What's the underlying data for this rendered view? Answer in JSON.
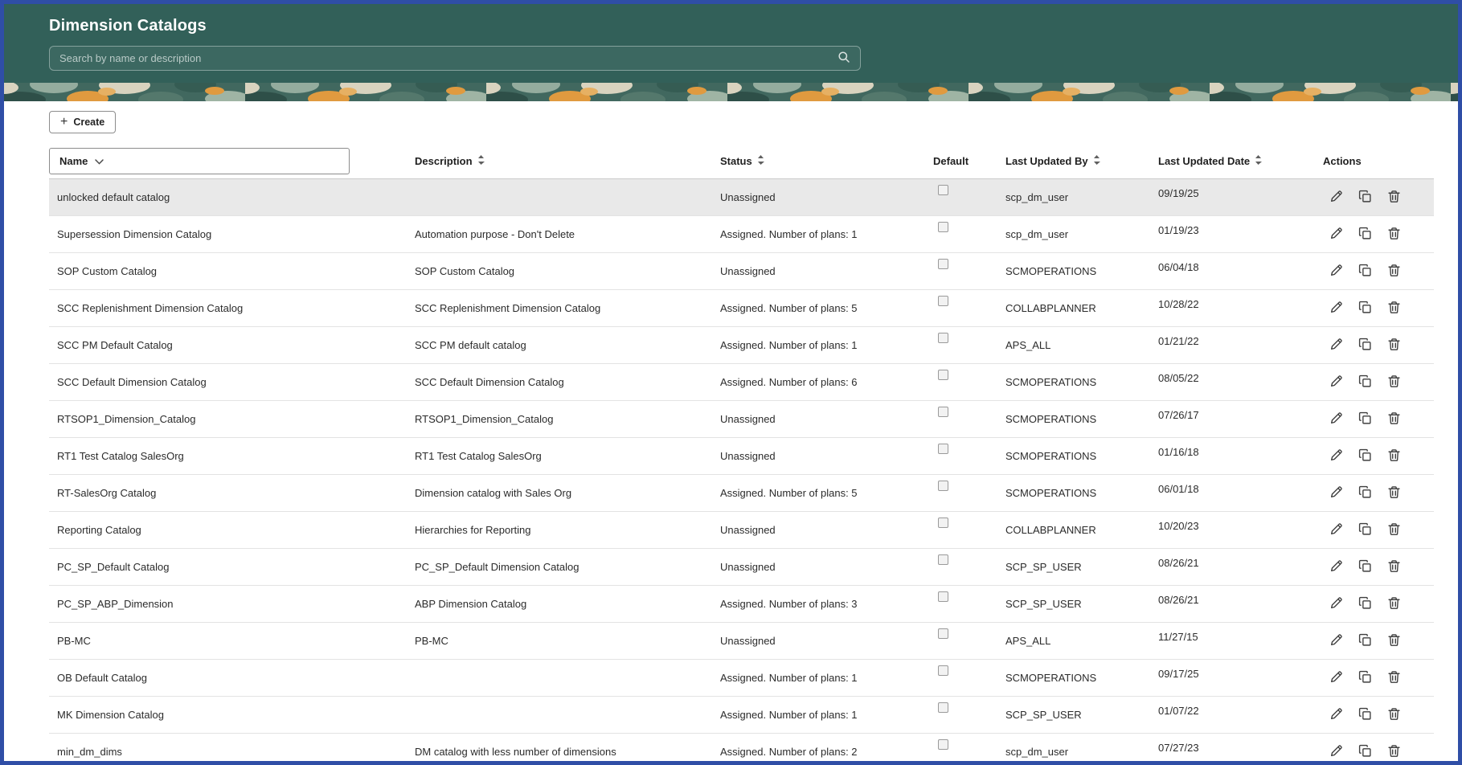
{
  "header": {
    "title": "Dimension Catalogs",
    "search_placeholder": "Search by name or description"
  },
  "toolbar": {
    "plus_glyph": "+",
    "create_label": "Create"
  },
  "colors": {
    "header_teal": "#326059",
    "frame_blue": "#2f4ea6",
    "banner_orange": "#e09a3f",
    "selected_row_gray": "#e9e9e9"
  },
  "table": {
    "columns": [
      "Name",
      "Description",
      "Status",
      "Default",
      "Last Updated By",
      "Last Updated Date",
      "Actions"
    ],
    "row_actions": [
      "edit-icon",
      "duplicate-icon",
      "delete-icon"
    ],
    "rows": [
      {
        "name": "unlocked default catalog",
        "description": "",
        "status": "Unassigned",
        "default": false,
        "last_updated_by": "scp_dm_user",
        "last_updated_date": "09/19/25",
        "selected": true
      },
      {
        "name": "Supersession Dimension Catalog",
        "description": "Automation purpose - Don't Delete",
        "status": "Assigned. Number of plans: 1",
        "default": false,
        "last_updated_by": "scp_dm_user",
        "last_updated_date": "01/19/23"
      },
      {
        "name": "SOP Custom Catalog",
        "description": "SOP Custom Catalog",
        "status": "Unassigned",
        "default": false,
        "last_updated_by": "SCMOPERATIONS",
        "last_updated_date": "06/04/18"
      },
      {
        "name": "SCC Replenishment Dimension Catalog",
        "description": "SCC Replenishment Dimension Catalog",
        "status": "Assigned. Number of plans: 5",
        "default": false,
        "last_updated_by": "COLLABPLANNER",
        "last_updated_date": "10/28/22"
      },
      {
        "name": "SCC PM Default Catalog",
        "description": "SCC PM default catalog",
        "status": "Assigned. Number of plans: 1",
        "default": false,
        "last_updated_by": "APS_ALL",
        "last_updated_date": "01/21/22"
      },
      {
        "name": "SCC Default Dimension Catalog",
        "description": "SCC Default Dimension Catalog",
        "status": "Assigned. Number of plans: 6",
        "default": false,
        "last_updated_by": "SCMOPERATIONS",
        "last_updated_date": "08/05/22"
      },
      {
        "name": "RTSOP1_Dimension_Catalog",
        "description": "RTSOP1_Dimension_Catalog",
        "status": "Unassigned",
        "default": false,
        "last_updated_by": "SCMOPERATIONS",
        "last_updated_date": "07/26/17"
      },
      {
        "name": "RT1 Test Catalog SalesOrg",
        "description": "RT1 Test Catalog SalesOrg",
        "status": "Unassigned",
        "default": false,
        "last_updated_by": "SCMOPERATIONS",
        "last_updated_date": "01/16/18"
      },
      {
        "name": "RT-SalesOrg Catalog",
        "description": "Dimension catalog with Sales Org",
        "status": "Assigned. Number of plans: 5",
        "default": false,
        "last_updated_by": "SCMOPERATIONS",
        "last_updated_date": "06/01/18"
      },
      {
        "name": "Reporting Catalog",
        "description": "Hierarchies for Reporting",
        "status": "Unassigned",
        "default": false,
        "last_updated_by": "COLLABPLANNER",
        "last_updated_date": "10/20/23"
      },
      {
        "name": "PC_SP_Default Catalog",
        "description": "PC_SP_Default Dimension Catalog",
        "status": "Unassigned",
        "default": false,
        "last_updated_by": "SCP_SP_USER",
        "last_updated_date": "08/26/21"
      },
      {
        "name": "PC_SP_ABP_Dimension",
        "description": "ABP Dimension Catalog",
        "status": "Assigned. Number of plans: 3",
        "default": false,
        "last_updated_by": "SCP_SP_USER",
        "last_updated_date": "08/26/21"
      },
      {
        "name": "PB-MC",
        "description": "PB-MC",
        "status": "Unassigned",
        "default": false,
        "last_updated_by": "APS_ALL",
        "last_updated_date": "11/27/15"
      },
      {
        "name": "OB Default Catalog",
        "description": "",
        "status": "Assigned. Number of plans: 1",
        "default": false,
        "last_updated_by": "SCMOPERATIONS",
        "last_updated_date": "09/17/25"
      },
      {
        "name": "MK Dimension Catalog",
        "description": "",
        "status": "Assigned. Number of plans: 1",
        "default": false,
        "last_updated_by": "SCP_SP_USER",
        "last_updated_date": "01/07/22"
      },
      {
        "name": "min_dm_dims",
        "description": "DM catalog with less number of dimensions",
        "status": "Assigned. Number of plans: 2",
        "default": false,
        "last_updated_by": "scp_dm_user",
        "last_updated_date": "07/27/23"
      }
    ]
  }
}
